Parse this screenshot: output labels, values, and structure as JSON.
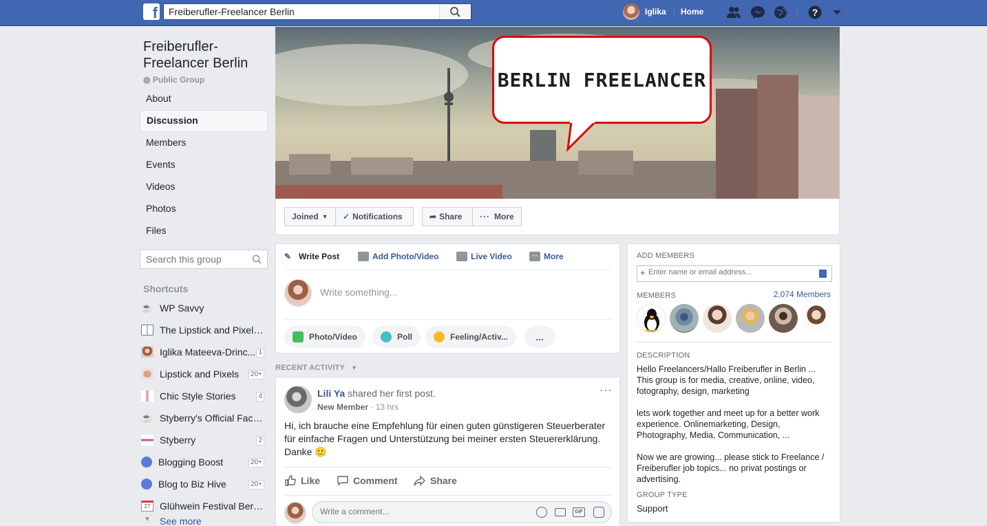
{
  "topbar": {
    "search_value": "Freiberufler-Freelancer Berlin",
    "user_name": "Iglika",
    "home_label": "Home",
    "logo_letter": "f"
  },
  "group": {
    "title": "Freiberufler-Freelancer Berlin",
    "privacy": "Public Group",
    "nav": [
      "About",
      "Discussion",
      "Members",
      "Events",
      "Videos",
      "Photos",
      "Files"
    ],
    "active_nav": "Discussion",
    "search_placeholder": "Search this group"
  },
  "shortcuts": {
    "title": "Shortcuts",
    "items": [
      {
        "label": "WP Savvy",
        "badge": "",
        "icon": "coffee-icon"
      },
      {
        "label": "The Lipstick and Pixels ...",
        "badge": "",
        "icon": "book-icon"
      },
      {
        "label": "Iglika Mateeva-Drinc...",
        "badge": "1",
        "icon": "profile-icon"
      },
      {
        "label": "Lipstick and Pixels",
        "badge": "20+",
        "icon": "lips-icon"
      },
      {
        "label": "Chic Style Stories",
        "badge": "4",
        "icon": "figure-icon"
      },
      {
        "label": "Styberry's Official Face...",
        "badge": "",
        "icon": "coffee-icon"
      },
      {
        "label": "Styberry",
        "badge": "2",
        "icon": "brand-icon"
      },
      {
        "label": "Blogging Boost",
        "badge": "20+",
        "icon": "group-icon"
      },
      {
        "label": "Blog to Biz Hive",
        "badge": "20+",
        "icon": "group-icon"
      },
      {
        "label": "Glühwein Festival Berli...",
        "badge": "",
        "icon": "calendar-icon"
      }
    ],
    "see_more": "See more"
  },
  "cover": {
    "bubble_text": "BERLIN FREELANCER"
  },
  "cover_actions": {
    "joined": "Joined",
    "notifications": "Notifications",
    "share": "Share",
    "more": "More"
  },
  "composer": {
    "tabs": [
      "Write Post",
      "Add Photo/Video",
      "Live Video",
      "More"
    ],
    "placeholder": "Write something...",
    "pills": [
      "Photo/Video",
      "Poll",
      "Feeling/Activ...",
      "..."
    ]
  },
  "recent_activity": "RECENT ACTIVITY",
  "post": {
    "author": "Lili Ya",
    "action": " shared her first post.",
    "role": "New Member",
    "time": " · 13 hrs",
    "text": "Hi, ich brauche eine Empfehlung für einen guten günstigeren Steuerberater für einfache Fragen und Unterstützung bei meiner ersten Steuererklärung. Danke 🙂",
    "actions": [
      "Like",
      "Comment",
      "Share"
    ],
    "comment_placeholder": "Write a comment..."
  },
  "right": {
    "add_members_label": "ADD MEMBERS",
    "add_members_placeholder": "Enter name or email address...",
    "members_label": "MEMBERS",
    "members_count": "2,074 Members",
    "description_label": "DESCRIPTION",
    "description": "Hello Freelancers/Hallo Freiberufler in Berlin ... This group is for media, creative, online, video, fotography, design, marketing\n\nlets work together and meet up for a better work experience. Onlinemarketing, Design, Photography, Media, Communication, ...\n\nNow we are growing... please stick to Freelance / Freiberufler job topics... no privat postings or advertising.",
    "group_type_label": "GROUP TYPE",
    "group_type": "Support"
  },
  "colors": {
    "brand": "#4267b2",
    "link": "#365899",
    "background": "#e9ebee",
    "bubble_border": "#e00000"
  }
}
